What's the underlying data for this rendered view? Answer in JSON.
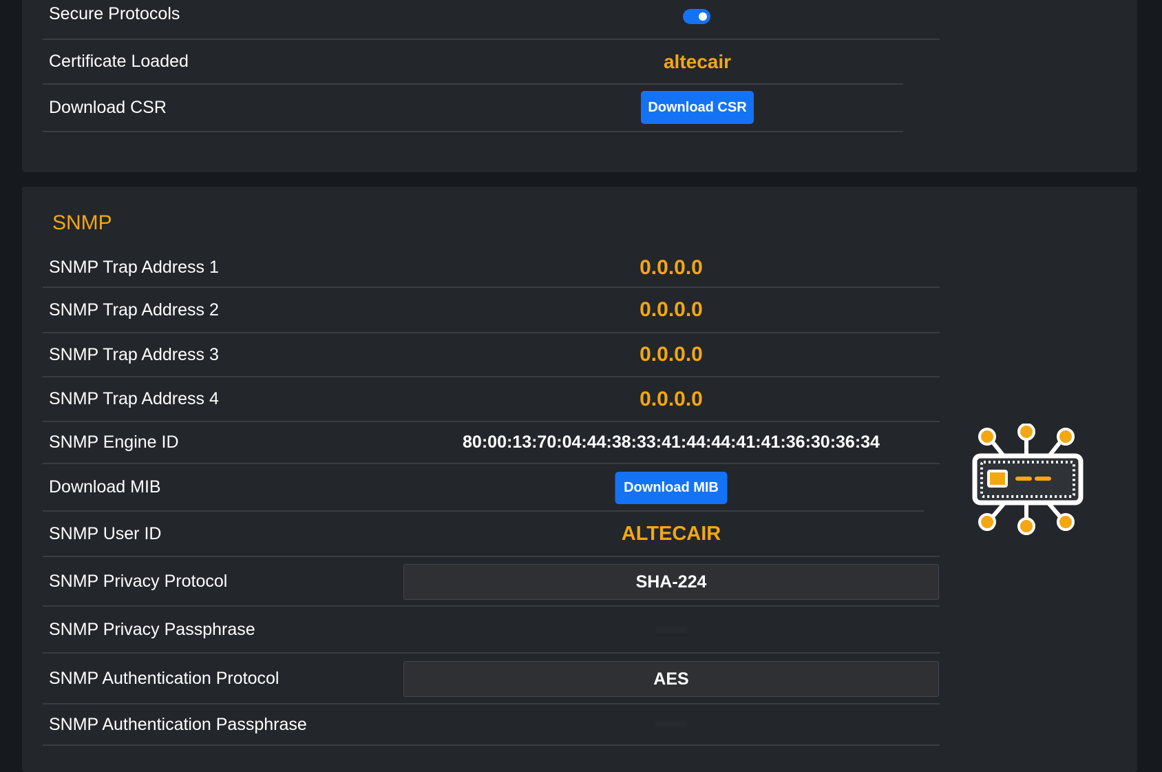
{
  "security": {
    "rows": [
      {
        "label": "Secure Protocols",
        "toggle_on": true
      },
      {
        "label": "Certificate Loaded",
        "value": "altecair"
      },
      {
        "label": "Download CSR",
        "button": "Download CSR"
      }
    ]
  },
  "snmp": {
    "title": "SNMP",
    "rows": [
      {
        "label": "SNMP Trap Address 1",
        "value": "0.0.0.0"
      },
      {
        "label": "SNMP Trap Address 2",
        "value": "0.0.0.0"
      },
      {
        "label": "SNMP Trap Address 3",
        "value": "0.0.0.0"
      },
      {
        "label": "SNMP Trap Address 4",
        "value": "0.0.0.0"
      },
      {
        "label": "SNMP Engine ID",
        "value": "80:00:13:70:04:44:38:33:41:44:44:41:41:36:30:36:34"
      },
      {
        "label": "Download MIB",
        "button": "Download MIB"
      },
      {
        "label": "SNMP User ID",
        "value": "ALTECAIR"
      },
      {
        "label": "SNMP Privacy Protocol",
        "selected": "SHA-224"
      },
      {
        "label": "SNMP Privacy Passphrase",
        "masked_value": "••••••"
      },
      {
        "label": "SNMP Authentication Protocol",
        "selected": "AES"
      },
      {
        "label": "SNMP Authentication Passphrase",
        "masked_value": "••••••"
      }
    ],
    "icon": "network-module-icon"
  },
  "colors": {
    "accent": "#f3a712",
    "button": "#1473f5",
    "card": "#23262b",
    "background": "#16191d"
  }
}
